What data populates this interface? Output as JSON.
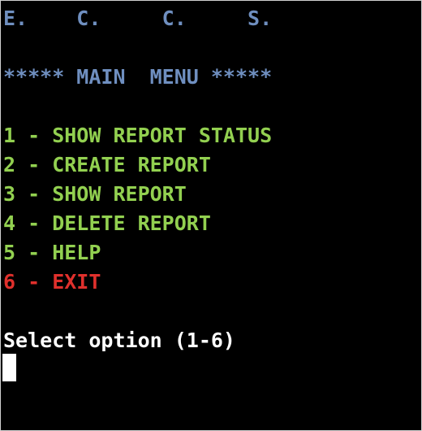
{
  "header": {
    "title_line": "E.    C.     C.     S.",
    "menu_title": "***** MAIN  MENU *****"
  },
  "menu": {
    "items": [
      {
        "label": "1 - SHOW REPORT STATUS"
      },
      {
        "label": "2 - CREATE REPORT"
      },
      {
        "label": "3 - SHOW REPORT"
      },
      {
        "label": "4 - DELETE REPORT"
      },
      {
        "label": "5 - HELP"
      },
      {
        "label": "6 - EXIT"
      }
    ]
  },
  "prompt": {
    "text": "Select option (1-6)"
  },
  "colors": {
    "header": "#6f8fc0",
    "menu_item": "#92d050",
    "exit_item": "#e0302c",
    "prompt": "#ffffff",
    "background": "#000000"
  }
}
